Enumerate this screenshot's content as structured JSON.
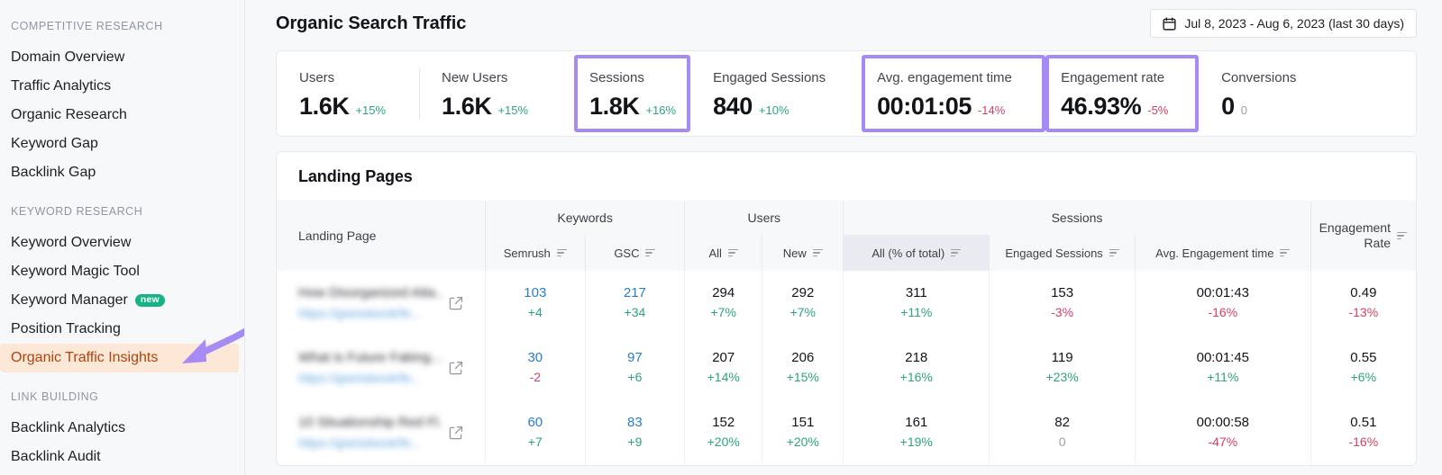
{
  "sidebar": {
    "sections": [
      {
        "label": "COMPETITIVE RESEARCH",
        "items": [
          {
            "label": "Domain Overview"
          },
          {
            "label": "Traffic Analytics"
          },
          {
            "label": "Organic Research"
          },
          {
            "label": "Keyword Gap"
          },
          {
            "label": "Backlink Gap"
          }
        ]
      },
      {
        "label": "KEYWORD RESEARCH",
        "items": [
          {
            "label": "Keyword Overview"
          },
          {
            "label": "Keyword Magic Tool"
          },
          {
            "label": "Keyword Manager",
            "badge": "new"
          },
          {
            "label": "Position Tracking"
          },
          {
            "label": "Organic Traffic Insights",
            "active": true
          }
        ]
      },
      {
        "label": "LINK BUILDING",
        "items": [
          {
            "label": "Backlink Analytics"
          },
          {
            "label": "Backlink Audit"
          }
        ]
      }
    ]
  },
  "header": {
    "title": "Organic Search Traffic",
    "date_range": "Jul 8, 2023 - Aug 6, 2023 (last 30 days)",
    "calendar_icon": "calendar-icon"
  },
  "metrics": [
    {
      "label": "Users",
      "value": "1.6K",
      "delta": "+15%",
      "trend": "up",
      "highlighted": false
    },
    {
      "label": "New Users",
      "value": "1.6K",
      "delta": "+15%",
      "trend": "up",
      "highlighted": false
    },
    {
      "label": "Sessions",
      "value": "1.8K",
      "delta": "+16%",
      "trend": "up",
      "highlighted": true
    },
    {
      "label": "Engaged Sessions",
      "value": "840",
      "delta": "+10%",
      "trend": "up",
      "highlighted": false
    },
    {
      "label": "Avg. engagement time",
      "value": "00:01:05",
      "delta": "-14%",
      "trend": "down",
      "highlighted": true
    },
    {
      "label": "Engagement rate",
      "value": "46.93%",
      "delta": "-5%",
      "trend": "down",
      "highlighted": true
    },
    {
      "label": "Conversions",
      "value": "0",
      "delta": "0",
      "trend": "zero",
      "highlighted": false
    }
  ],
  "landing_pages": {
    "title": "Landing Pages",
    "first_column": "Landing Page",
    "groups": [
      {
        "label": "Keywords",
        "span": 2
      },
      {
        "label": "Users",
        "span": 2
      },
      {
        "label": "Sessions",
        "span": 3
      }
    ],
    "last_group": "Engagement Rate",
    "columns": [
      {
        "label": "Semrush",
        "sorted": false
      },
      {
        "label": "GSC",
        "sorted": false
      },
      {
        "label": "All",
        "sorted": false
      },
      {
        "label": "New",
        "sorted": false
      },
      {
        "label": "All (% of total)",
        "sorted": true
      },
      {
        "label": "Engaged Sessions",
        "sorted": false
      },
      {
        "label": "Avg. Engagement time",
        "sorted": false
      }
    ],
    "rows": [
      {
        "page_title": "How Disorganized Atta...",
        "page_url": "https://gianisbook/fe...",
        "external_icon": "external-link-icon",
        "cells": [
          {
            "value": "103",
            "delta": "+4",
            "trend": "up",
            "link": true
          },
          {
            "value": "217",
            "delta": "+34",
            "trend": "up",
            "link": true
          },
          {
            "value": "294",
            "delta": "+7%",
            "trend": "up",
            "link": false
          },
          {
            "value": "292",
            "delta": "+7%",
            "trend": "up",
            "link": false
          },
          {
            "value": "311",
            "delta": "+11%",
            "trend": "up",
            "link": false
          },
          {
            "value": "153",
            "delta": "-3%",
            "trend": "down",
            "link": false
          },
          {
            "value": "00:01:43",
            "delta": "-16%",
            "trend": "down",
            "link": false
          },
          {
            "value": "0.49",
            "delta": "-13%",
            "trend": "down",
            "link": false
          }
        ]
      },
      {
        "page_title": "What is Future Faking...",
        "page_url": "https://gianisbook/fe...",
        "external_icon": "external-link-icon",
        "cells": [
          {
            "value": "30",
            "delta": "-2",
            "trend": "down",
            "link": true
          },
          {
            "value": "97",
            "delta": "+6",
            "trend": "up",
            "link": true
          },
          {
            "value": "207",
            "delta": "+14%",
            "trend": "up",
            "link": false
          },
          {
            "value": "206",
            "delta": "+15%",
            "trend": "up",
            "link": false
          },
          {
            "value": "218",
            "delta": "+16%",
            "trend": "up",
            "link": false
          },
          {
            "value": "119",
            "delta": "+23%",
            "trend": "up",
            "link": false
          },
          {
            "value": "00:01:45",
            "delta": "+11%",
            "trend": "up",
            "link": false
          },
          {
            "value": "0.55",
            "delta": "+6%",
            "trend": "up",
            "link": false
          }
        ]
      },
      {
        "page_title": "10 Situationship Red Fl...",
        "page_url": "https://gianisbook/fe...",
        "external_icon": "external-link-icon",
        "cells": [
          {
            "value": "60",
            "delta": "+7",
            "trend": "up",
            "link": true
          },
          {
            "value": "83",
            "delta": "+9",
            "trend": "up",
            "link": true
          },
          {
            "value": "152",
            "delta": "+20%",
            "trend": "up",
            "link": false
          },
          {
            "value": "151",
            "delta": "+20%",
            "trend": "up",
            "link": false
          },
          {
            "value": "161",
            "delta": "+19%",
            "trend": "up",
            "link": false
          },
          {
            "value": "82",
            "delta": "0",
            "trend": "zero",
            "link": false
          },
          {
            "value": "00:00:58",
            "delta": "-47%",
            "trend": "down",
            "link": false
          },
          {
            "value": "0.51",
            "delta": "-16%",
            "trend": "down",
            "link": false
          }
        ]
      }
    ]
  },
  "annotations": {
    "arrow_color": "#a78bf5",
    "highlight_border_color": "#a78bf5",
    "active_item_bg": "#fde7d6",
    "active_item_color": "#b1430c",
    "badge_color": "#16b387",
    "up_color": "#2ea37d",
    "down_color": "#d34165"
  }
}
